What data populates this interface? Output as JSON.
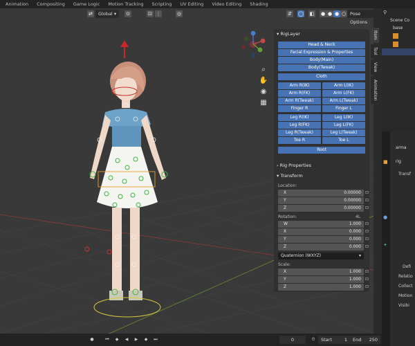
{
  "workspace_tabs": [
    "Animation",
    "Compositing",
    "Game Logic",
    "Motion Tracking",
    "Scripting",
    "UV Editing",
    "Video Editing",
    "Shading"
  ],
  "viewport": {
    "transform_orientation": "Global",
    "pose_options": "Pose Options"
  },
  "side_tabs": [
    "Item",
    "Tool",
    "View",
    "Animation"
  ],
  "rig_layer": {
    "title": "RigLayer",
    "head_neck": "Head & Neck",
    "facial": "Facial Expression & Properties",
    "body_main": "Body(Main)",
    "body_tweak": "Body(Tweak)",
    "cloth": "Cloth",
    "arm_r_ik": "Arm R(IK)",
    "arm_l_ik": "Arm L(IK)",
    "arm_r_fk": "Arm R(FK)",
    "arm_l_fk": "Arm L(FK)",
    "arm_r_tweak": "Arm R(Tweak)",
    "arm_l_tweak": "Arm L(Tweak)",
    "finger_r": "Finger R",
    "finger_l": "Finger L",
    "leg_r_ik": "Leg R(IK)",
    "leg_l_ik": "Leg L(IK)",
    "leg_r_fk": "Leg R(FK)",
    "leg_l_fk": "Leg L(FK)",
    "leg_r_tweak": "Leg R(Tweak)",
    "leg_l_tweak": "Leg L(Tweak)",
    "toe_r": "Toe R",
    "toe_l": "Toe L",
    "root": "Root"
  },
  "rig_properties": {
    "title": "Rig Properties"
  },
  "transform": {
    "title": "Transform",
    "location_label": "Location:",
    "location": [
      {
        "axis": "X",
        "value": "0.00000"
      },
      {
        "axis": "Y",
        "value": "0.00000"
      },
      {
        "axis": "Z",
        "value": "0.00000"
      }
    ],
    "rotation_label": "Rotation:",
    "rotation_lock_label": "4L",
    "rotation": [
      {
        "axis": "W",
        "value": "1.000"
      },
      {
        "axis": "X",
        "value": "0.000"
      },
      {
        "axis": "Y",
        "value": "0.000"
      },
      {
        "axis": "Z",
        "value": "0.000"
      }
    ],
    "rotation_mode": "Quaternion (WXYZ)",
    "scale_label": "Scale:",
    "scale": [
      {
        "axis": "X",
        "value": "1.000"
      },
      {
        "axis": "Y",
        "value": "1.000"
      },
      {
        "axis": "Z",
        "value": "1.000"
      }
    ]
  },
  "outliner": {
    "title": "Scene Co",
    "items": [
      "base"
    ]
  },
  "properties": {
    "object_name": "arma",
    "bone_name": "rig",
    "sections": [
      "Transf",
      "Defi",
      "Relatio",
      "Collect",
      "Motion",
      "Visibi"
    ]
  },
  "timeline": {
    "current_frame": "0",
    "start_label": "Start",
    "start_value": "1",
    "end_label": "End",
    "end_value": "250"
  },
  "colors": {
    "accent_blue": "#4772b3",
    "panel_bg": "#303030",
    "viewport_bg": "#393939"
  }
}
